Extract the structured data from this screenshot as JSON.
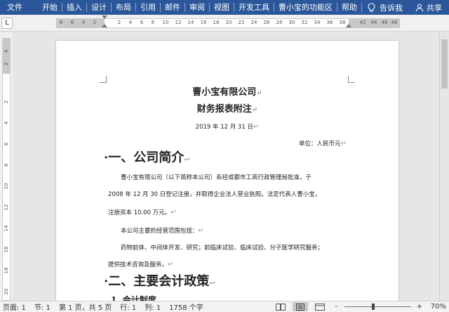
{
  "ribbon": {
    "tabs": [
      "文件",
      "开始",
      "插入",
      "设计",
      "布局",
      "引用",
      "邮件",
      "审阅",
      "视图",
      "开发工具",
      "曹小宝的功能区",
      "帮助"
    ],
    "tell_me": "告诉我",
    "share": "共享",
    "bg_color": "#2b579a"
  },
  "ruler": {
    "tab_selector": "L",
    "ticks": [
      "8",
      "6",
      "4",
      "2",
      "2",
      "4",
      "6",
      "8",
      "10",
      "12",
      "14",
      "16",
      "18",
      "20",
      "22",
      "24",
      "26",
      "28",
      "30",
      "32",
      "34",
      "36",
      "38",
      "42",
      "44",
      "46",
      "48"
    ],
    "vticks": [
      "4",
      "2",
      "2",
      "4",
      "6",
      "8",
      "10",
      "12",
      "14",
      "16",
      "18",
      "20"
    ]
  },
  "document": {
    "company": "曹小宝有限公司",
    "subtitle": "财务报表附注",
    "date": "2019 年 12 月 31 日",
    "unit": "单位：人民币元",
    "section1": "·一、公司简介",
    "para1_line1": "曹小宝有限公司（以下简称本公司）系经成都市工商行政管理局批准，于",
    "para1_line2": "2008 年 12 月 30 日登记注册，并取得企业法人营业执照。法定代表人曹小宝，",
    "para1_line3": "注册资本 10.00 万元。",
    "para2": "本公司主要的经营范围包括：",
    "para3_line1": "药物前体、中间体开发、研究；前临床试验、临床试验、分子医学研究服务；",
    "para3_line2": "提供技术咨询及服务。",
    "section2": "·二、主要会计政策",
    "section2_1": "1. 会计制度",
    "para_mark": "↵",
    "para_mark_alt": "↩"
  },
  "status": {
    "page": "页面: 1",
    "section": "节: 1",
    "page_of": "第 1 页，共 5 页",
    "row": "行: 1",
    "column": "列: 1",
    "words": "1758 个字",
    "zoom_minus": "-",
    "zoom_plus": "+",
    "zoom": "70%",
    "zoom_fraction": 0.43
  }
}
